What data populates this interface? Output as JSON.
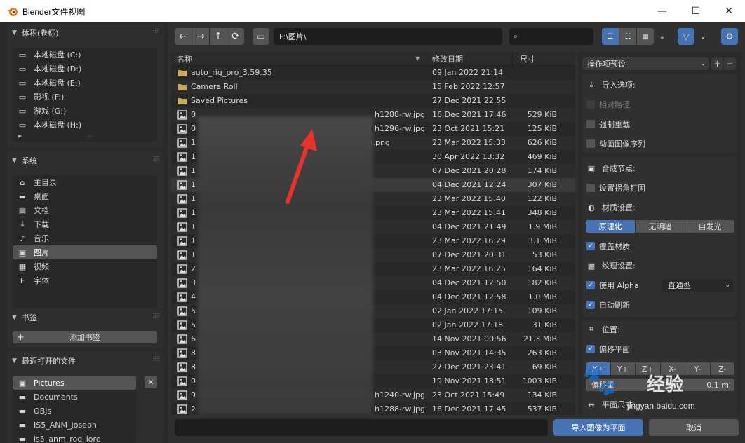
{
  "window": {
    "title": "Blender文件视图",
    "minimize": "—",
    "maximize": "☐",
    "close": "✕"
  },
  "sidebar": {
    "volumes": {
      "title": "体积(卷标)",
      "items": [
        {
          "label": "本地磁盘 (C:)",
          "icon": "disk-icon"
        },
        {
          "label": "本地磁盘 (D:)",
          "icon": "disk-icon"
        },
        {
          "label": "本地磁盘 (E:)",
          "icon": "disk-icon"
        },
        {
          "label": "影视 (F:)",
          "icon": "disk-icon"
        },
        {
          "label": "游戏 (G:)",
          "icon": "disk-icon"
        },
        {
          "label": "本地磁盘 (H:)",
          "icon": "disk-icon"
        }
      ]
    },
    "system": {
      "title": "系统",
      "items": [
        {
          "label": "主目录",
          "icon": "home-icon"
        },
        {
          "label": "桌面",
          "icon": "desktop-icon"
        },
        {
          "label": "文档",
          "icon": "document-icon"
        },
        {
          "label": "下载",
          "icon": "download-icon"
        },
        {
          "label": "音乐",
          "icon": "music-icon"
        },
        {
          "label": "图片",
          "icon": "image-icon"
        },
        {
          "label": "视频",
          "icon": "video-icon"
        },
        {
          "label": "字体",
          "icon": "font-icon"
        }
      ]
    },
    "bookmarks": {
      "title": "书签",
      "add_label": "添加书签"
    },
    "recent": {
      "title": "最近打开的文件",
      "items": [
        {
          "label": "Pictures",
          "icon": "image-icon"
        },
        {
          "label": "Documents",
          "icon": "folder-icon"
        },
        {
          "label": "OBJs",
          "icon": "folder-icon"
        },
        {
          "label": "IS5_ANM_Joseph",
          "icon": "folder-icon"
        },
        {
          "label": "is5_anm_rod_lore",
          "icon": "folder-icon"
        }
      ]
    }
  },
  "toolbar": {
    "path": "F:\\图片\\"
  },
  "filelist": {
    "headers": {
      "name": "名称",
      "date": "修改日期",
      "size": "尺寸"
    },
    "rows": [
      {
        "name": "auto_rig_pro_3.59.35",
        "date": "09 Jan 2022 21:14",
        "size": "",
        "type": "folder"
      },
      {
        "name": "Camera Roll",
        "date": "15 Feb 2022 12:57",
        "size": "",
        "type": "folder"
      },
      {
        "name": "Saved Pictures",
        "date": "27 Dec 2021 22:55",
        "size": "",
        "type": "folder"
      },
      {
        "name": "0",
        "suffix": "h1288-rw.jpg",
        "date": "16 Dec 2021 17:46",
        "size": "529 KiB",
        "type": "image"
      },
      {
        "name": "0",
        "suffix": "h1296-rw.jpg",
        "date": "23 Oct 2021 15:21",
        "size": "125 KiB",
        "type": "image"
      },
      {
        "name": "1",
        "suffix": "_n.png",
        "date": "23 Mar 2022 15:33",
        "size": "626 KiB",
        "type": "image"
      },
      {
        "name": "1",
        "suffix": "",
        "date": "30 Apr 2022 13:32",
        "size": "469 KiB",
        "type": "image"
      },
      {
        "name": "1",
        "suffix": "",
        "date": "07 Dec 2021 20:28",
        "size": "174 KiB",
        "type": "image"
      },
      {
        "name": "1",
        "suffix": "",
        "date": "04 Dec 2021 12:24",
        "size": "307 KiB",
        "type": "image"
      },
      {
        "name": "1",
        "suffix": "",
        "date": "23 Mar 2022 15:40",
        "size": "122 KiB",
        "type": "image"
      },
      {
        "name": "1",
        "suffix": "",
        "date": "23 Mar 2022 15:41",
        "size": "348 KiB",
        "type": "image"
      },
      {
        "name": "1",
        "suffix": "",
        "date": "04 Dec 2021 21:49",
        "size": "1.9 MiB",
        "type": "image"
      },
      {
        "name": "1",
        "suffix": "",
        "date": "23 Mar 2022 16:29",
        "size": "3.1 MiB",
        "type": "image"
      },
      {
        "name": "1",
        "suffix": "",
        "date": "07 Dec 2021 20:31",
        "size": "53 KiB",
        "type": "image"
      },
      {
        "name": "2",
        "suffix": "",
        "date": "23 Mar 2022 16:25",
        "size": "164 KiB",
        "type": "image"
      },
      {
        "name": "3",
        "suffix": "",
        "date": "04 Dec 2021 12:50",
        "size": "182 KiB",
        "type": "image"
      },
      {
        "name": "4",
        "suffix": "",
        "date": "04 Dec 2021 12:58",
        "size": "1.0 MiB",
        "type": "image"
      },
      {
        "name": "5",
        "suffix": "",
        "date": "02 Jan 2022 17:15",
        "size": "109 KiB",
        "type": "image"
      },
      {
        "name": "5",
        "suffix": "",
        "date": "02 Jan 2022 17:18",
        "size": "31 KiB",
        "type": "image"
      },
      {
        "name": "6",
        "suffix": "",
        "date": "14 Nov 2021 00:56",
        "size": "21.3 MiB",
        "type": "image"
      },
      {
        "name": "8",
        "suffix": "",
        "date": "03 Nov 2021 14:35",
        "size": "263 KiB",
        "type": "image"
      },
      {
        "name": "8",
        "suffix": "",
        "date": "27 Dec 2021 23:41",
        "size": "69 KiB",
        "type": "image"
      },
      {
        "name": "0",
        "suffix": "",
        "date": "19 Nov 2021 18:51",
        "size": "1003 KiB",
        "type": "image"
      },
      {
        "name": "9",
        "suffix": "h1240-rw.jpg",
        "date": "23 Oct 2021 15:49",
        "size": "134 KiB",
        "type": "image"
      },
      {
        "name": "2",
        "suffix": "h1288-rw.jpg",
        "date": "16 Dec 2021 17:45",
        "size": "537 KiB",
        "type": "image"
      }
    ]
  },
  "footer": {
    "import_label": "导入图像为平面",
    "cancel_label": "取消"
  },
  "options": {
    "preset_label": "操作项预设",
    "import_options": "导入选项:",
    "relative_path": "相对路径",
    "force_reload": "强制重载",
    "anim_sequence": "动画图像序列",
    "compositing_nodes": "合成节点:",
    "setup_corner_pin": "设置拐角钉固",
    "material_settings": "材质设置:",
    "shader_options": [
      "原理化",
      "无明暗",
      "自发光"
    ],
    "override_material": "覆盖材质",
    "texture_settings": "纹理设置:",
    "use_alpha": "使用 Alpha",
    "alpha_mode": "直通型",
    "auto_refresh": "自动刷新",
    "position": "位置:",
    "offset_planes": "偏移平面",
    "axis_options": [
      "X+",
      "Y+",
      "Z+",
      "X-",
      "Y-",
      "Z-"
    ],
    "offset_label": "偏移量",
    "offset_value": "0.1 m",
    "plane_size": "平面尺寸:"
  },
  "watermark": {
    "text": "经验",
    "url": "jingyan.baidu.com"
  },
  "colors": {
    "accent": "#4772b3",
    "bg": "#303030",
    "arrow": "#e8322d"
  }
}
